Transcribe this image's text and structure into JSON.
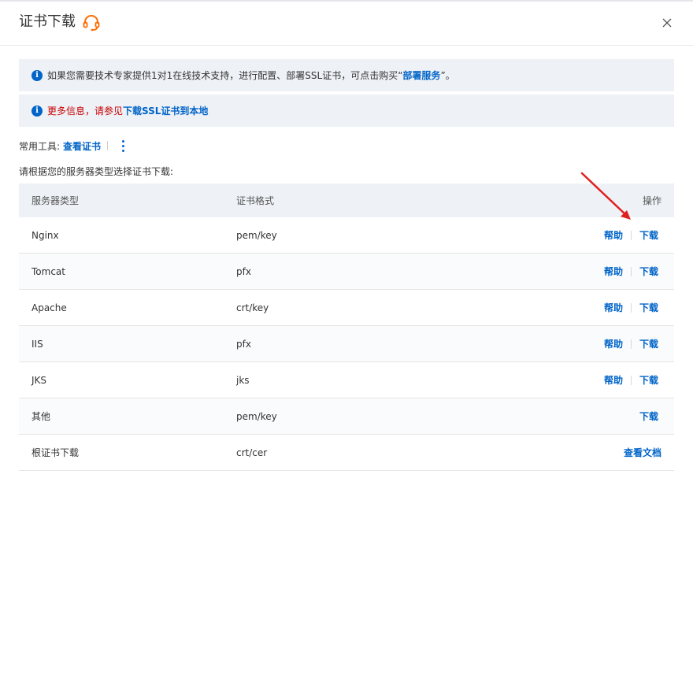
{
  "dialog": {
    "title": "证书下载"
  },
  "notices": {
    "n1_prefix": "如果您需要技术专家提供1对1在线技术支持，进行配置、部署SSL证书，可点击购买“",
    "n1_link": "部署服务",
    "n1_suffix": "”。",
    "n2_prefix": "更多信息，请参见",
    "n2_link": "下载SSL证书到本地"
  },
  "tools": {
    "label": "常用工具:",
    "link": "查看证书"
  },
  "prompt": "请根据您的服务器类型选择证书下载:",
  "table": {
    "headers": [
      "服务器类型",
      "证书格式",
      "操作"
    ],
    "rows": [
      {
        "server": "Nginx",
        "format": "pem/key",
        "help": "帮助",
        "download": "下载"
      },
      {
        "server": "Tomcat",
        "format": "pfx",
        "help": "帮助",
        "download": "下载"
      },
      {
        "server": "Apache",
        "format": "crt/key",
        "help": "帮助",
        "download": "下载"
      },
      {
        "server": "IIS",
        "format": "pfx",
        "help": "帮助",
        "download": "下载"
      },
      {
        "server": "JKS",
        "format": "jks",
        "help": "帮助",
        "download": "下载"
      },
      {
        "server": "其他",
        "format": "pem/key",
        "download": "下载"
      },
      {
        "server": "根证书下载",
        "format": "crt/cer",
        "docs": "查看文档"
      }
    ]
  },
  "icons": {
    "headset": "headset-icon",
    "close": "close-icon",
    "info": "info-icon",
    "more": "more-vertical-icon"
  },
  "colors": {
    "link": "#0064c8",
    "warning_text": "#c80000",
    "headset": "#ff6a00",
    "annotation_arrow": "#e02020"
  }
}
